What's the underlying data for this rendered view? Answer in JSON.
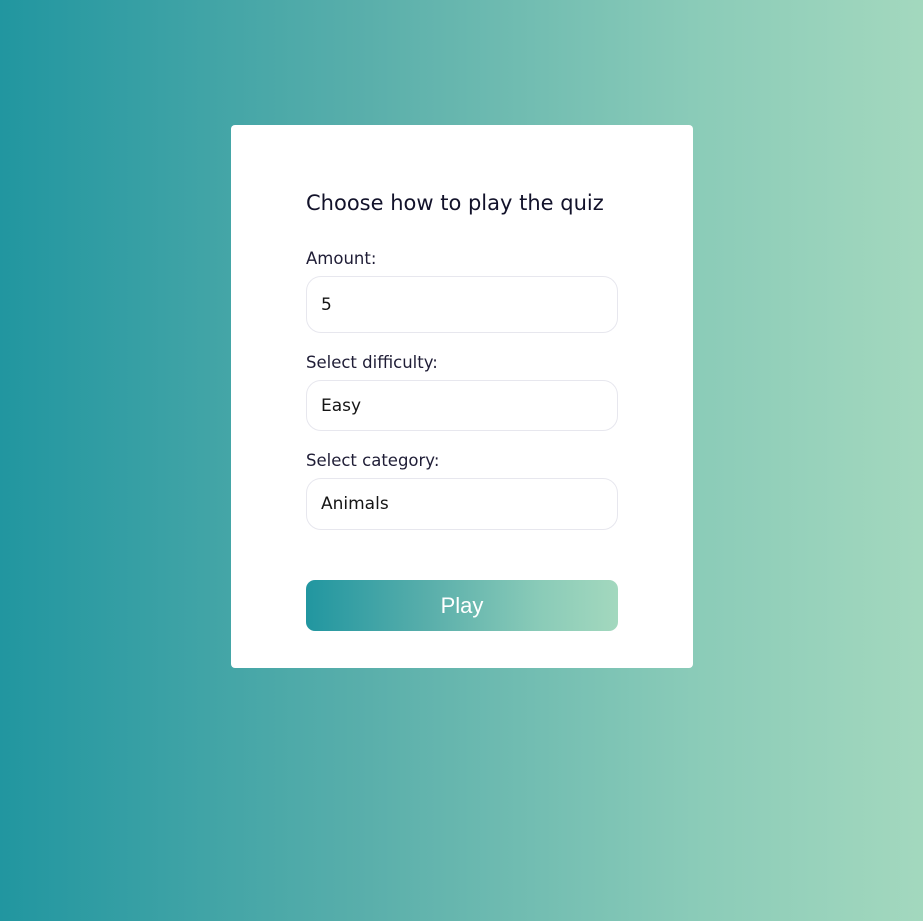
{
  "form": {
    "title": "Choose how to play the quiz",
    "amount": {
      "label": "Amount:",
      "value": "5"
    },
    "difficulty": {
      "label": "Select difficulty:",
      "selected": "Easy"
    },
    "category": {
      "label": "Select category:",
      "selected": "Animals"
    },
    "play_label": "Play"
  },
  "colors": {
    "gradient_start": "#2196a0",
    "gradient_end": "#a3d8be",
    "card_background": "#ffffff",
    "text_dark": "#12122a"
  }
}
